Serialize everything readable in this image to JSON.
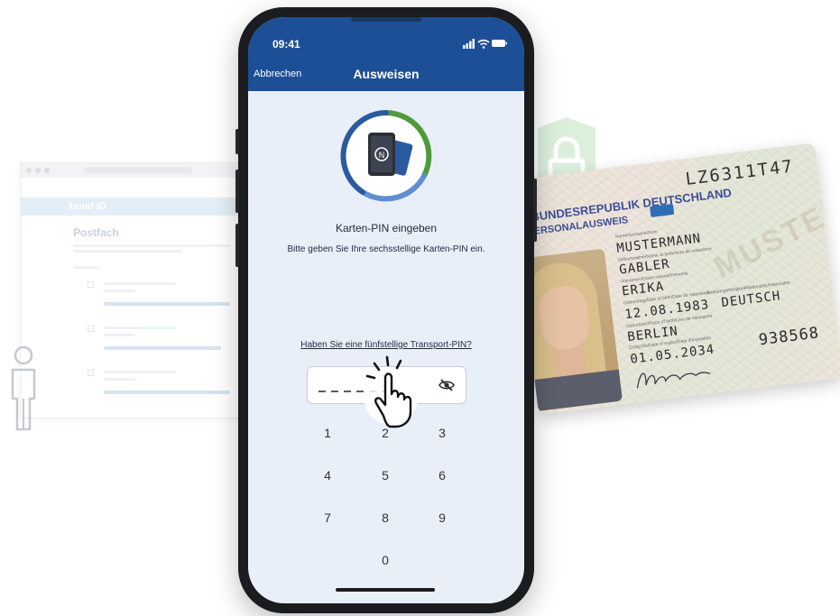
{
  "background_web": {
    "brand": "bund ID",
    "page_title": "Postfach"
  },
  "status_bar": {
    "time": "09:41"
  },
  "navigation": {
    "cancel_label": "Abbrechen",
    "title": "Ausweisen"
  },
  "pin_entry": {
    "heading": "Karten-PIN eingeben",
    "instruction": "Bitte geben Sie Ihre sechsstellige Karten-PIN ein.",
    "transport_link": "Haben Sie eine fünfstellige Transport-PIN?",
    "visibility_icon": "eye-slash-icon"
  },
  "keypad": {
    "keys": [
      "1",
      "2",
      "3",
      "4",
      "5",
      "6",
      "7",
      "8",
      "9",
      "0"
    ]
  },
  "id_card": {
    "card_number": "LZ6311T47",
    "country": "BUNDESREPUBLIK DEUTSCHLAND",
    "type": "PERSONALAUSWEIS",
    "surname_label": "Name/Surname/Nom",
    "surname": "MUSTERMANN",
    "birth_name_label": "Geburtsname/Name at birth/Nom de naissance",
    "birth_name": "GABLER",
    "given_names_label": "Vornamen/Given names/Prénoms",
    "given_names": "ERIKA",
    "dob_label": "Geburtstag/Date of birth/Date de naissance",
    "dob": "12.08.1983",
    "nationality_label": "Staatsangehörigkeit/Nationality/Nationalité",
    "nationality": "DEUTSCH",
    "pob_label": "Geburtsort/Place of birth/Lieu de naissance",
    "pob": "BERLIN",
    "expiry_label": "Gültig bis/Date of expiry/Date d'expiration",
    "expiry": "01.05.2034",
    "can": "938568",
    "watermark": "MUSTER"
  },
  "colors": {
    "nav_blue": "#1d4f96",
    "screen_bg": "#e9eff8",
    "ring_green": "#4f9a3c",
    "ring_blue": "#2a5aa0",
    "lock_green": "#dcefdc"
  }
}
